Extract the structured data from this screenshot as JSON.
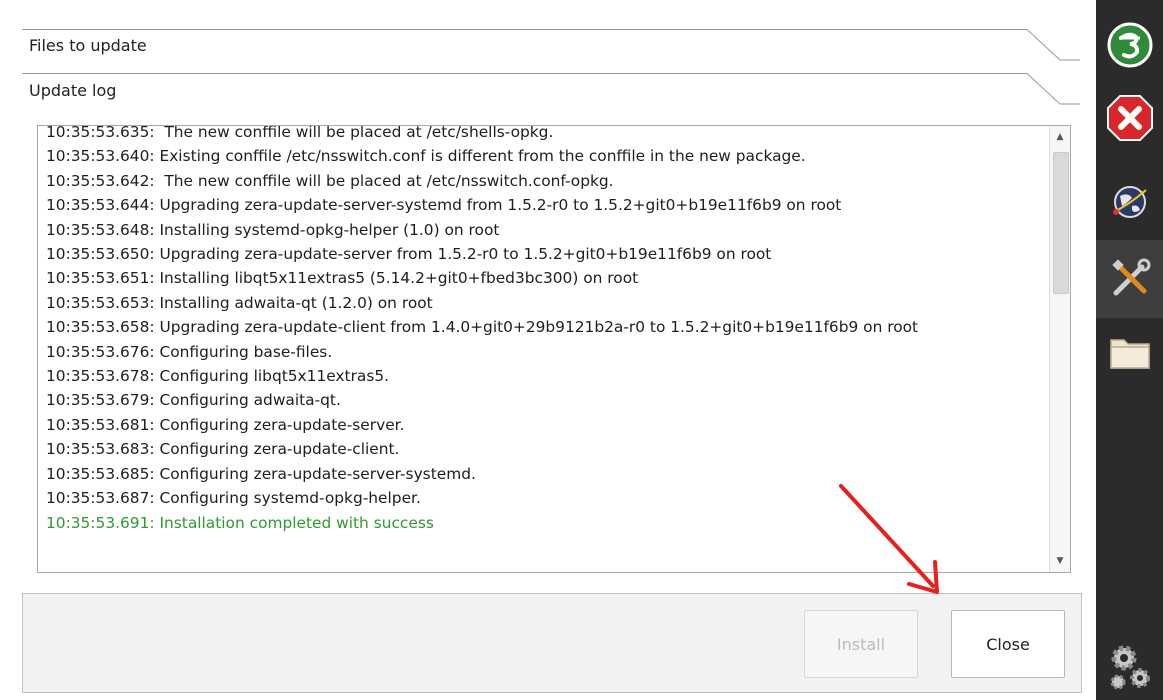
{
  "sections": {
    "files_to_update": "Files to update",
    "update_log": "Update log"
  },
  "log": {
    "lines": [
      "10:35:53.635:  The new conffile will be placed at /etc/shells-opkg.",
      "10:35:53.640: Existing conffile /etc/nsswitch.conf is different from the conffile in the new package.",
      "10:35:53.642:  The new conffile will be placed at /etc/nsswitch.conf-opkg.",
      "10:35:53.644: Upgrading zera-update-server-systemd from 1.5.2-r0 to 1.5.2+git0+b19e11f6b9 on root",
      "10:35:53.648: Installing systemd-opkg-helper (1.0) on root",
      "10:35:53.650: Upgrading zera-update-server from 1.5.2-r0 to 1.5.2+git0+b19e11f6b9 on root",
      "10:35:53.651: Installing libqt5x11extras5 (5.14.2+git0+fbed3bc300) on root",
      "10:35:53.653: Installing adwaita-qt (1.2.0) on root",
      "10:35:53.658: Upgrading zera-update-client from 1.4.0+git0+29b9121b2a-r0 to 1.5.2+git0+b19e11f6b9 on root",
      "10:35:53.676: Configuring base-files.",
      "10:35:53.678: Configuring libqt5x11extras5.",
      "10:35:53.679: Configuring adwaita-qt.",
      "10:35:53.681: Configuring zera-update-server.",
      "10:35:53.683: Configuring zera-update-client.",
      "10:35:53.685: Configuring zera-update-server-systemd.",
      "10:35:53.687: Configuring systemd-opkg-helper."
    ],
    "success_line": "10:35:53.691: Installation completed with success"
  },
  "buttons": {
    "install": "Install",
    "close": "Close"
  },
  "colors": {
    "success": "#2e9a2e",
    "annotation": "#e8201c",
    "sidebar": "#2b2b2b",
    "logo": "#2f8a3a",
    "close_app": "#d9262a"
  },
  "sidebar": {
    "items": [
      {
        "icon": "app-logo-icon"
      },
      {
        "icon": "close-app-icon"
      },
      {
        "icon": "globe-network-icon"
      },
      {
        "icon": "tools-icon",
        "active": true
      },
      {
        "icon": "folder-icon"
      },
      {
        "icon": "settings-gears-icon"
      }
    ]
  }
}
